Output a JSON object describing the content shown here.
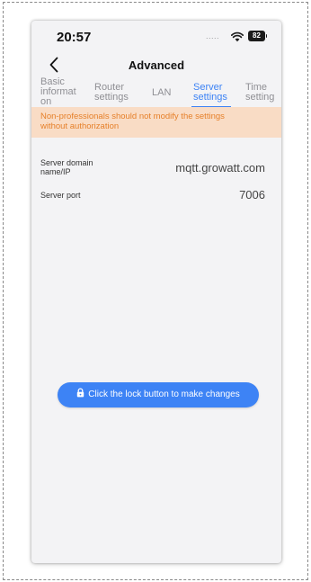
{
  "status_bar": {
    "time": "20:57",
    "signal": ".....",
    "battery": "82"
  },
  "nav": {
    "title": "Advanced"
  },
  "tabs": [
    {
      "label_lines": [
        "Basic",
        "informati",
        "on"
      ],
      "active": false
    },
    {
      "label_lines": [
        "Router",
        "settings"
      ],
      "active": false
    },
    {
      "label_lines": [
        "LAN"
      ],
      "active": false
    },
    {
      "label_lines": [
        "Server",
        "settings"
      ],
      "active": true
    },
    {
      "label_lines": [
        "Time",
        "setting"
      ],
      "active": false
    }
  ],
  "warning": {
    "line1": "Non-professionals should not modify the settings",
    "line2": "without authorization"
  },
  "settings": {
    "domain": {
      "label_line1": "Server domain",
      "label_line2": "name/IP",
      "value": "mqtt.growatt.com"
    },
    "port": {
      "label": "Server port",
      "value": "7006"
    }
  },
  "lock_notice": {
    "label": "Click the lock button to make changes"
  },
  "colors": {
    "accent": "#3d83f5",
    "warning_bg": "#f9dcc5",
    "warning_text": "#e6802a",
    "screen_bg": "#f3f3f5"
  }
}
